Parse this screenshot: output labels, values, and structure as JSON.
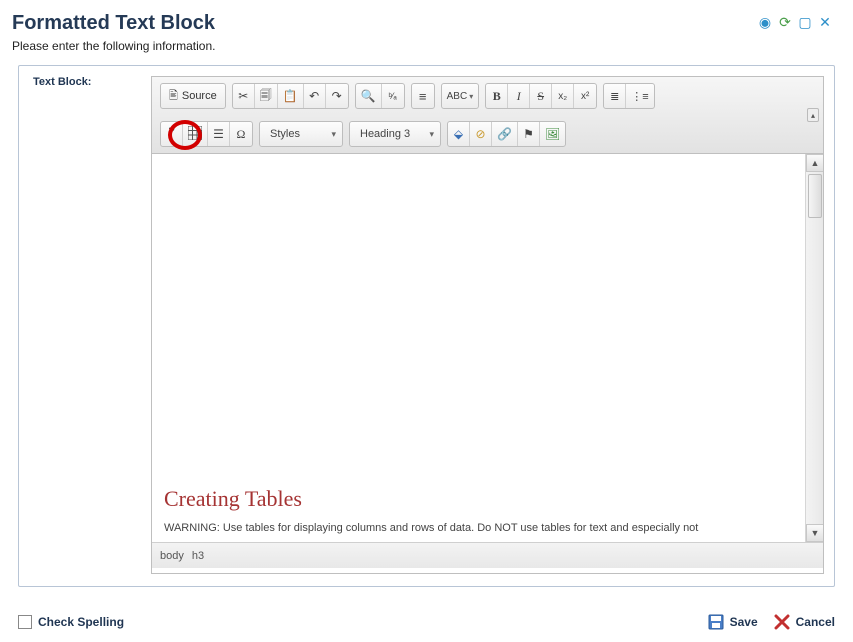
{
  "header": {
    "title": "Formatted Text Block",
    "subtitle": "Please enter the following information."
  },
  "field_label": "Text Block:",
  "toolbar": {
    "source": "Source",
    "styles": "Styles",
    "heading": "Heading 3"
  },
  "content": {
    "heading": "Creating Tables",
    "warning": "WARNING: Use tables for displaying columns and rows of data. Do NOT use tables for text and especially not"
  },
  "statusbar": {
    "path1": "body",
    "path2": "h3"
  },
  "footer": {
    "check_spelling": "Check Spelling",
    "save": "Save",
    "cancel": "Cancel"
  }
}
